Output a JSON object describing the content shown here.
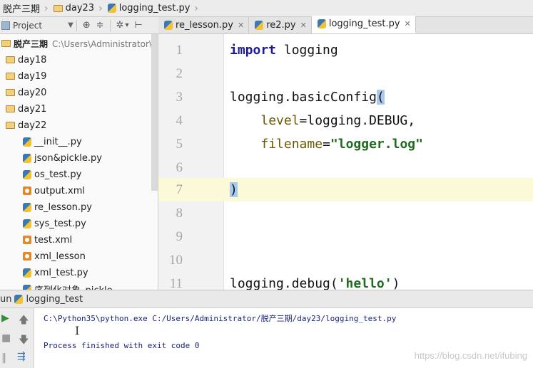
{
  "breadcrumb": [
    {
      "label": "脱产三期",
      "icon": "folder-icon"
    },
    {
      "label": "day23",
      "icon": "folder-icon"
    },
    {
      "label": "logging_test.py",
      "icon": "python-file-icon"
    }
  ],
  "project_toolbar": {
    "label": "Project",
    "icons": [
      "globe-icon",
      "collapse-icon",
      "gear-icon",
      "pin-icon"
    ]
  },
  "tabs": [
    {
      "label": "re_lesson.py",
      "active": false
    },
    {
      "label": "re2.py",
      "active": false
    },
    {
      "label": "logging_test.py",
      "active": true
    }
  ],
  "tree": {
    "root_name": "脱产三期",
    "root_path": "C:\\Users\\Administrator\\脱",
    "folders": [
      "day18",
      "day19",
      "day20",
      "day21",
      "day22"
    ],
    "files": [
      {
        "name": "__init__.py",
        "type": "py"
      },
      {
        "name": "json&pickle.py",
        "type": "py"
      },
      {
        "name": "os_test.py",
        "type": "py"
      },
      {
        "name": "output.xml",
        "type": "xml"
      },
      {
        "name": "re_lesson.py",
        "type": "py"
      },
      {
        "name": "sys_test.py",
        "type": "py"
      },
      {
        "name": "test.xml",
        "type": "xml"
      },
      {
        "name": "xml_lesson",
        "type": "xml"
      },
      {
        "name": "xml_test.py",
        "type": "py"
      },
      {
        "name": "序列化对象_pickle",
        "type": "py"
      }
    ]
  },
  "editor": {
    "line_numbers": [
      "1",
      "2",
      "3",
      "4",
      "5",
      "6",
      "7",
      "8",
      "9",
      "10",
      "11"
    ],
    "lines": [
      {
        "kw": "import",
        "rest": " logging"
      },
      {
        "text": ""
      },
      {
        "text": "logging.basicConfig",
        "brace": "("
      },
      {
        "indent": "    ",
        "param": "level",
        "text": "=logging.DEBUG,"
      },
      {
        "indent": "    ",
        "param": "filename",
        "text": "=",
        "str": "\"logger.log\""
      },
      {
        "text": ""
      },
      {
        "brace": ")"
      },
      {
        "text": ""
      },
      {
        "text": ""
      },
      {
        "text": ""
      },
      {
        "text": "logging.debug(",
        "str": "'hello'",
        "after": ")"
      }
    ]
  },
  "run": {
    "prefix": "un",
    "title": "logging_test",
    "output": [
      "C:\\Python35\\python.exe C:/Users/Administrator/脱产三期/day23/logging_test.py",
      "Process finished with exit code 0"
    ]
  },
  "watermark": "https://blog.csdn.net/ifubing"
}
